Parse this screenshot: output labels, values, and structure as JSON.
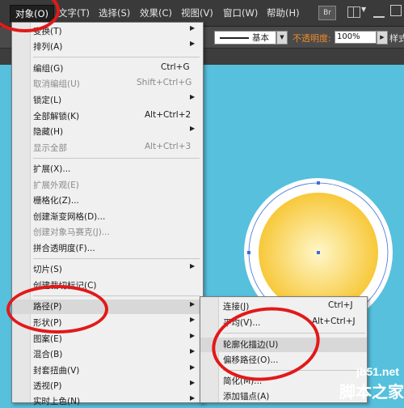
{
  "menubar": {
    "items": [
      "对象(O)",
      "文字(T)",
      "选择(S)",
      "效果(C)",
      "视图(V)",
      "窗口(W)",
      "帮助(H)"
    ],
    "br_label": "Br"
  },
  "control_bar": {
    "stroke_label": "基本",
    "opacity_label": "不透明度:",
    "opacity_value": "100%",
    "style_label": "样式"
  },
  "object_menu": {
    "items": [
      {
        "label": "变换(T)",
        "shortcut": "",
        "submenu": true,
        "disabled": false
      },
      {
        "label": "排列(A)",
        "shortcut": "",
        "submenu": true,
        "disabled": false
      },
      {
        "label": "编组(G)",
        "shortcut": "Ctrl+G",
        "submenu": false,
        "disabled": false
      },
      {
        "label": "取消编组(U)",
        "shortcut": "Shift+Ctrl+G",
        "submenu": false,
        "disabled": true
      },
      {
        "label": "锁定(L)",
        "shortcut": "",
        "submenu": true,
        "disabled": false
      },
      {
        "label": "全部解锁(K)",
        "shortcut": "Alt+Ctrl+2",
        "submenu": false,
        "disabled": false
      },
      {
        "label": "隐藏(H)",
        "shortcut": "",
        "submenu": true,
        "disabled": false
      },
      {
        "label": "显示全部",
        "shortcut": "Alt+Ctrl+3",
        "submenu": false,
        "disabled": true
      },
      {
        "label": "扩展(X)...",
        "shortcut": "",
        "submenu": false,
        "disabled": false
      },
      {
        "label": "扩展外观(E)",
        "shortcut": "",
        "submenu": false,
        "disabled": true
      },
      {
        "label": "栅格化(Z)...",
        "shortcut": "",
        "submenu": false,
        "disabled": false
      },
      {
        "label": "创建渐变网格(D)...",
        "shortcut": "",
        "submenu": false,
        "disabled": false
      },
      {
        "label": "创建对象马赛克(J)...",
        "shortcut": "",
        "submenu": false,
        "disabled": true
      },
      {
        "label": "拼合透明度(F)...",
        "shortcut": "",
        "submenu": false,
        "disabled": false
      },
      {
        "label": "切片(S)",
        "shortcut": "",
        "submenu": true,
        "disabled": false
      },
      {
        "label": "创建裁切标记(C)",
        "shortcut": "",
        "submenu": false,
        "disabled": false
      },
      {
        "label": "路径(P)",
        "shortcut": "",
        "submenu": true,
        "disabled": false
      },
      {
        "label": "形状(P)",
        "shortcut": "",
        "submenu": true,
        "disabled": false
      },
      {
        "label": "图案(E)",
        "shortcut": "",
        "submenu": true,
        "disabled": false
      },
      {
        "label": "混合(B)",
        "shortcut": "",
        "submenu": true,
        "disabled": false
      },
      {
        "label": "封套扭曲(V)",
        "shortcut": "",
        "submenu": true,
        "disabled": false
      },
      {
        "label": "透视(P)",
        "shortcut": "",
        "submenu": true,
        "disabled": false
      },
      {
        "label": "实时上色(N)",
        "shortcut": "",
        "submenu": true,
        "disabled": false
      }
    ]
  },
  "path_menu": {
    "items": [
      {
        "label": "连接(J)",
        "shortcut": "Ctrl+J"
      },
      {
        "label": "平均(V)...",
        "shortcut": "Alt+Ctrl+J"
      },
      {
        "label": "轮廓化描边(U)",
        "shortcut": ""
      },
      {
        "label": "偏移路径(O)...",
        "shortcut": ""
      },
      {
        "label": "简化(M)...",
        "shortcut": ""
      },
      {
        "label": "添加锚点(A)",
        "shortcut": ""
      }
    ]
  },
  "watermark": {
    "site": "jb51.net",
    "name": "脚本之家"
  },
  "colors": {
    "canvas": "#56c0dd",
    "annotation": "#e21919",
    "circle_center": "#fff7c9",
    "circle_edge": "#f7c83a"
  }
}
